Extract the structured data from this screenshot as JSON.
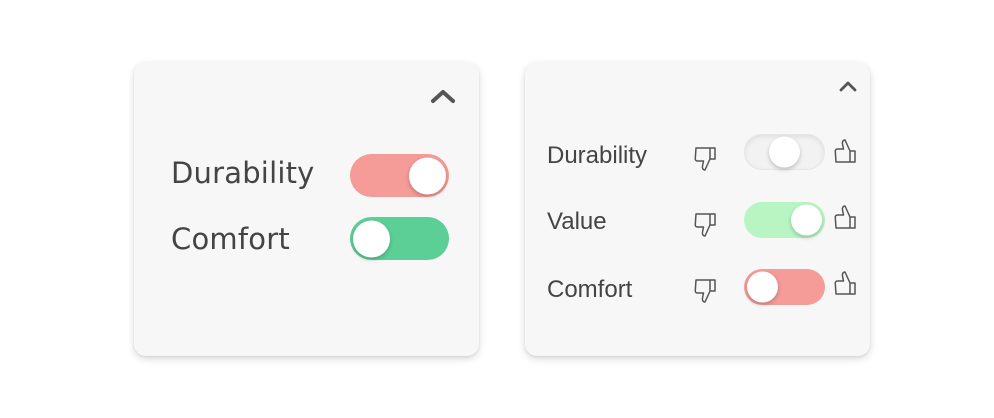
{
  "colors": {
    "card_bg": "#f7f7f7",
    "text": "#444444",
    "icon": "#555555",
    "toggle_negative": "#f59b98",
    "toggle_positive": "#5ccf97",
    "toggle_light_positive": "#b8f5c2",
    "toggle_neutral": "#f2f2f2",
    "knob": "#ffffff"
  },
  "panel_simple": {
    "collapse_icon": "chevron-up-icon",
    "rows": [
      {
        "label": "Durability",
        "toggle_color": "#f59b98",
        "knob_position": 1
      },
      {
        "label": "Comfort",
        "toggle_color": "#5ccf97",
        "knob_position": 0
      }
    ]
  },
  "panel_rating": {
    "collapse_icon": "chevron-up-icon",
    "left_icon": "thumbs-down-icon",
    "right_icon": "thumbs-up-icon",
    "rows": [
      {
        "label": "Durability",
        "toggle_color": "#f2f2f2",
        "knob_position": 0.5
      },
      {
        "label": "Value",
        "toggle_color": "#b8f5c2",
        "knob_position": 1
      },
      {
        "label": "Comfort",
        "toggle_color": "#f59b98",
        "knob_position": 0
      }
    ]
  }
}
